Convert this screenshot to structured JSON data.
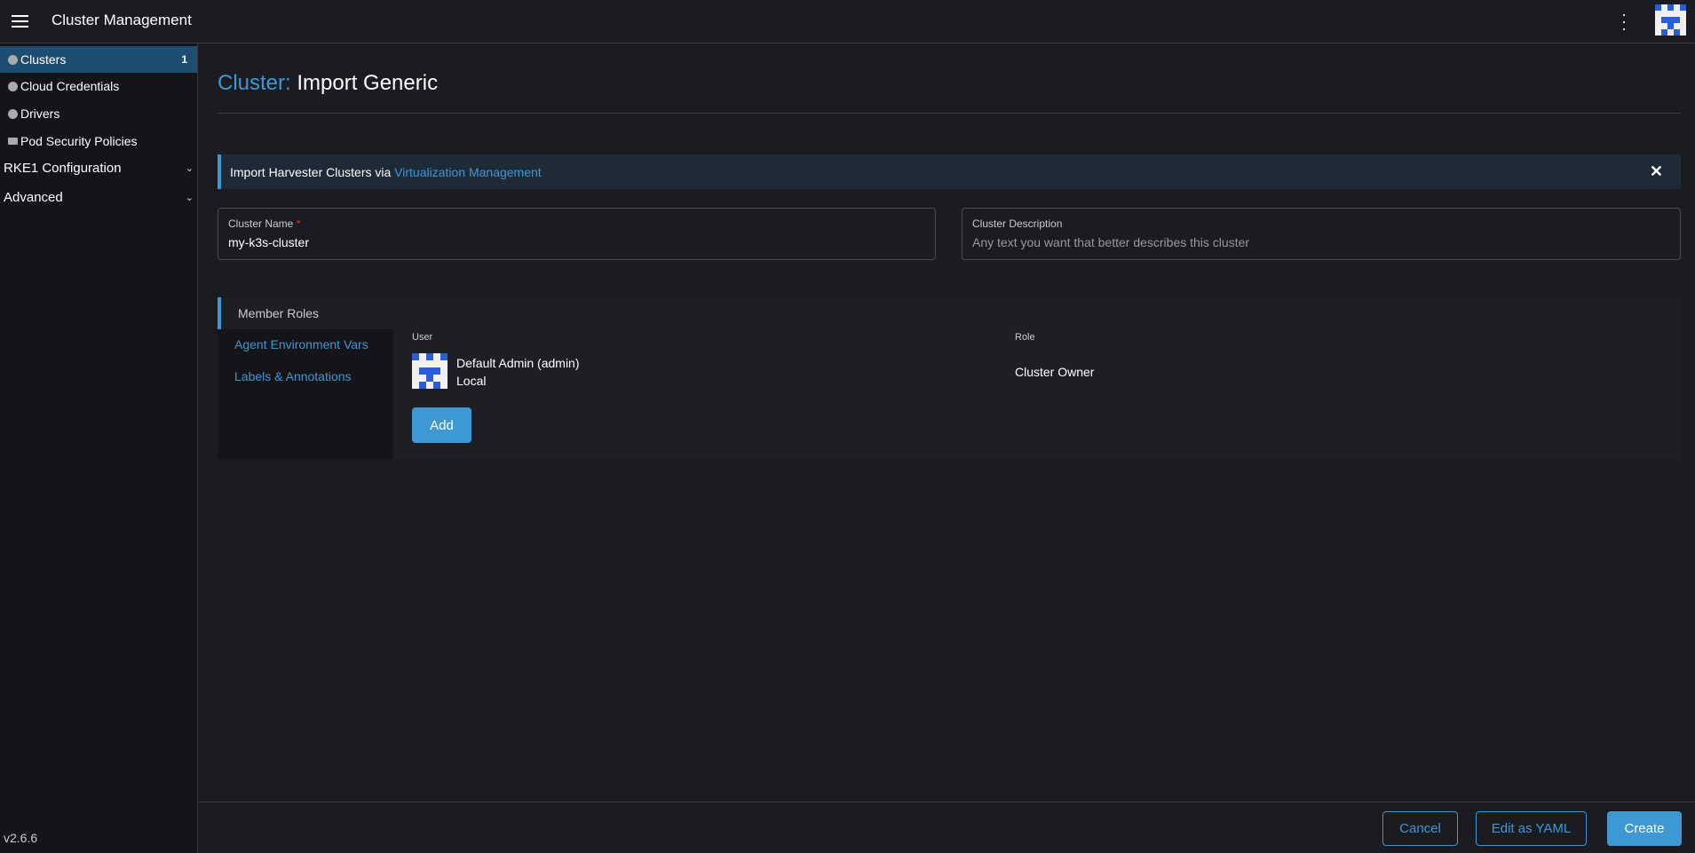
{
  "header": {
    "title": "Cluster Management",
    "menu_icon": "hamburger-icon",
    "kebab_icon": "kebab-icon"
  },
  "sidebar": {
    "items": [
      {
        "label": "Clusters",
        "count": "1",
        "icon": "globe-icon",
        "selected": true
      },
      {
        "label": "Cloud Credentials",
        "icon": "globe-icon"
      },
      {
        "label": "Drivers",
        "icon": "globe-icon"
      },
      {
        "label": "Pod Security Policies",
        "icon": "folder-icon"
      }
    ],
    "groups": [
      {
        "label": "RKE1 Configuration"
      },
      {
        "label": "Advanced"
      }
    ],
    "version": "v2.6.6"
  },
  "page": {
    "title_prefix": "Cluster:",
    "title": "Import Generic"
  },
  "banner": {
    "text": "Import Harvester Clusters via ",
    "link": "Virtualization Management"
  },
  "form": {
    "cluster_name": {
      "label": "Cluster Name",
      "required": "*",
      "value": "my-k3s-cluster"
    },
    "cluster_description": {
      "label": "Cluster Description",
      "placeholder": "Any text you want that better describes this cluster"
    }
  },
  "tabs": [
    {
      "label": "Member Roles",
      "active": true
    },
    {
      "label": "Agent Environment Vars"
    },
    {
      "label": "Labels & Annotations"
    }
  ],
  "members": {
    "user_header": "User",
    "role_header": "Role",
    "rows": [
      {
        "name": "Default Admin (admin)",
        "provider": "Local",
        "role": "Cluster Owner"
      }
    ],
    "add_label": "Add"
  },
  "footer": {
    "cancel": "Cancel",
    "yaml": "Edit as YAML",
    "create": "Create"
  },
  "colors": {
    "accent": "#3d98d3",
    "selected": "#1d4e72",
    "background": "#1b1c21"
  }
}
